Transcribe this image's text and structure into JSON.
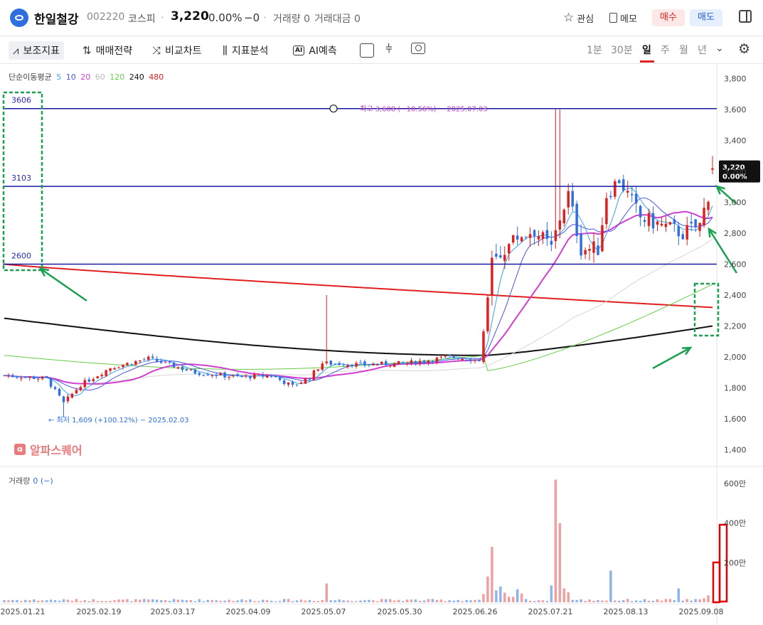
{
  "header": {
    "name": "한일철강",
    "code": "002220",
    "market": "코스피",
    "dot": "·",
    "price": "3,220",
    "change_pct": "0.00%",
    "change_abs": "−0",
    "volume": "거래량 0",
    "trade_value": "거래대금 0",
    "watch_label": "관심",
    "memo_label": "메모",
    "buy_label": "매수",
    "sell_label": "매도"
  },
  "toolbar": {
    "indicator": "보조지표",
    "strategy": "매매전략",
    "compare": "비교차트",
    "analysis": "지표분석",
    "ai": "AI예측",
    "periods": [
      "1분",
      "30분",
      "일",
      "주",
      "월",
      "년"
    ],
    "selected_period": "일"
  },
  "legend": {
    "ma_title": "단순이동평균",
    "ma_periods": [
      "5",
      "10",
      "20",
      "60",
      "120",
      "240",
      "480"
    ],
    "ma_colors": [
      "#3aa0e8",
      "#4a55e0",
      "#d040d0",
      "#bbbbbb",
      "#66cc44",
      "#111111",
      "#e02020"
    ]
  },
  "volume": {
    "label": "거래량",
    "value": "0 (−)"
  },
  "watermark": "알파스퀘어",
  "annotations": {
    "high": "최고 3,608 (−10.56%) − 2025.07.03",
    "low": "최저 1,609 (+100.12%) − 2025.02.03",
    "line_labels": [
      "3606",
      "3103",
      "2600"
    ]
  },
  "current_price": {
    "price": "3,220",
    "pct": "0.00%"
  },
  "axes": {
    "price_ticks": [
      "3,800",
      "3,600",
      "3,400",
      "3,200",
      "3,000",
      "2,800",
      "2,600",
      "2,400",
      "2,200",
      "2,000",
      "1,800",
      "1,600",
      "1,400"
    ],
    "volume_ticks": [
      "600만",
      "400만",
      "200만"
    ],
    "date_ticks": [
      "2025.01.21",
      "2025.02.19",
      "2025.03.17",
      "2025.04.09",
      "2025.05.07",
      "2025.05.30",
      "2025.06.26",
      "2025.07.21",
      "2025.08.13",
      "2025.09.08"
    ]
  },
  "colors": {
    "up": "#e02020",
    "down": "#2f6fe0",
    "hline": "#1a1aa0",
    "annotation": "#19a050"
  }
}
